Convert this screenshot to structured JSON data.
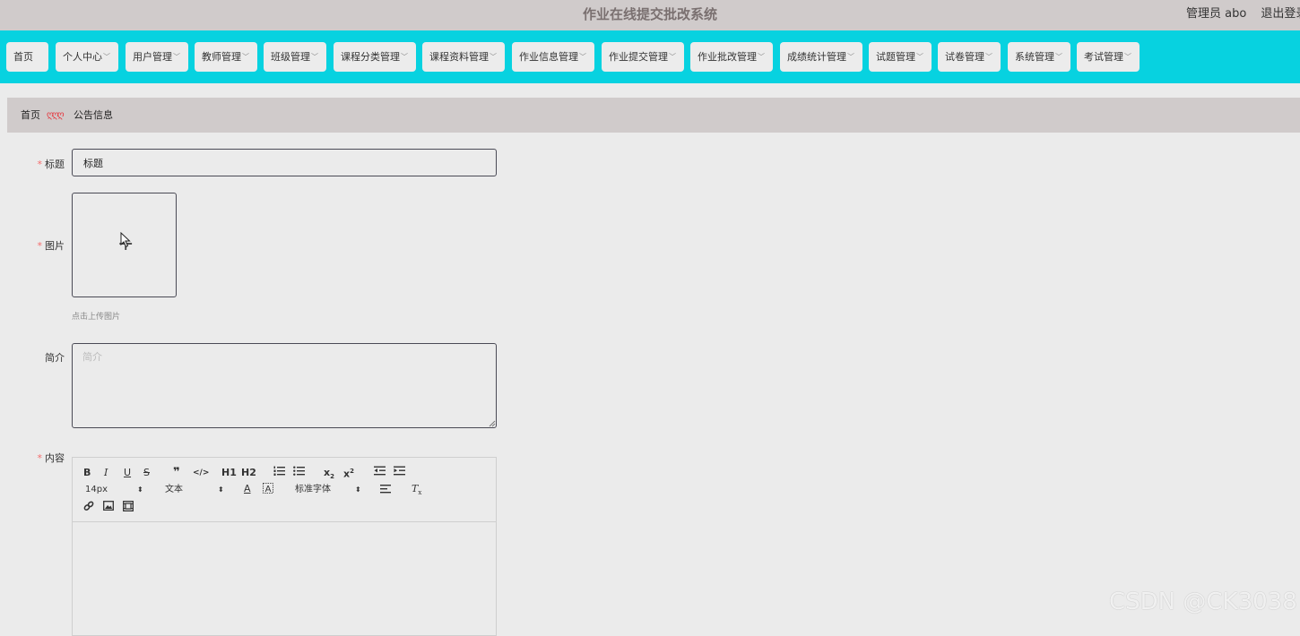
{
  "header": {
    "title": "作业在线提交批改系统",
    "user_label": "管理员 abo",
    "logout_label": "退出登录"
  },
  "nav": [
    {
      "label": "首页",
      "has_dropdown": false
    },
    {
      "label": "个人中心",
      "has_dropdown": true
    },
    {
      "label": "用户管理",
      "has_dropdown": true
    },
    {
      "label": "教师管理",
      "has_dropdown": true
    },
    {
      "label": "班级管理",
      "has_dropdown": true
    },
    {
      "label": "课程分类管理",
      "has_dropdown": true
    },
    {
      "label": "课程资料管理",
      "has_dropdown": true
    },
    {
      "label": "作业信息管理",
      "has_dropdown": true
    },
    {
      "label": "作业提交管理",
      "has_dropdown": true
    },
    {
      "label": "作业批改管理",
      "has_dropdown": true
    },
    {
      "label": "成绩统计管理",
      "has_dropdown": true
    },
    {
      "label": "试题管理",
      "has_dropdown": true
    },
    {
      "label": "试卷管理",
      "has_dropdown": true
    },
    {
      "label": "系统管理",
      "has_dropdown": true
    },
    {
      "label": "考试管理",
      "has_dropdown": true
    }
  ],
  "breadcrumb": {
    "home": "首页",
    "separator": "ღღღ",
    "current": "公告信息"
  },
  "form": {
    "title_label": "标题",
    "title_value": "标题",
    "image_label": "图片",
    "upload_hint": "点击上传图片",
    "intro_label": "简介",
    "intro_placeholder": "简介",
    "content_label": "内容",
    "required_mark": "*"
  },
  "editor": {
    "font_size": "14px",
    "block_format": "文本",
    "font_family": "标准字体",
    "h1": "H1",
    "h2": "H2",
    "bold": "B",
    "italic": "I",
    "underline": "U",
    "strike": "S"
  },
  "watermark": "CSDN @CK3038"
}
